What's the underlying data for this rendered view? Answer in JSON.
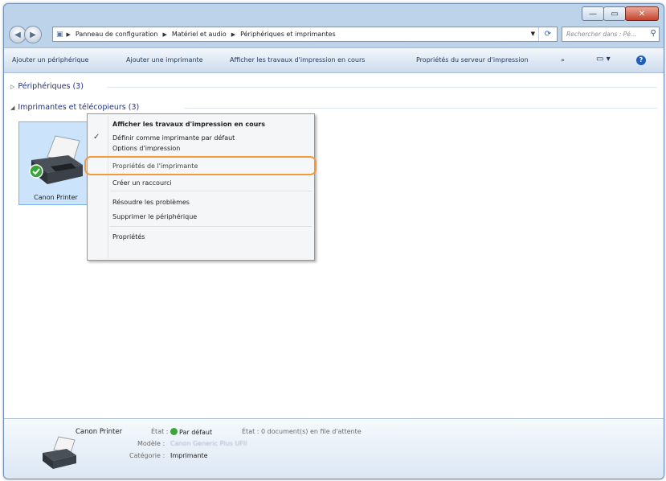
{
  "window": {
    "buttons": {
      "minimize": "—",
      "maximize": "▭",
      "close": "✕"
    }
  },
  "address": {
    "crumbs": [
      "Panneau de configuration",
      "Matériel et audio",
      "Périphériques et imprimantes"
    ],
    "search_placeholder": "Rechercher dans : Pé..."
  },
  "toolbar": {
    "items": [
      "Ajouter un périphérique",
      "Ajouter une imprimante",
      "Afficher les travaux d'impression en cours",
      "Propriétés du serveur d'impression"
    ],
    "more": "»"
  },
  "groups": {
    "devices": "Périphériques (3)",
    "printers": "Imprimantes et télécopieurs (3)"
  },
  "printers": [
    {
      "name": "Canon Printer",
      "default": true
    }
  ],
  "context_menu": {
    "items": [
      {
        "label": "Afficher les travaux d'impression en cours",
        "bold": true
      },
      {
        "label": "Définir comme imprimante par défaut",
        "checked": true
      },
      {
        "label": "Options d'impression"
      },
      {
        "label": "Propriétés de l'imprimante",
        "highlighted": true
      },
      {
        "label": "Créer un raccourci"
      },
      {
        "label": "Résoudre les problèmes"
      },
      {
        "label": "Supprimer le périphérique"
      },
      {
        "label": "Propriétés"
      }
    ]
  },
  "details": {
    "name": "Canon Printer",
    "state_key": "État :",
    "state_value": "Par défaut",
    "queue": "État : 0 document(s) en file d'attente",
    "model_key": "Modèle :",
    "model_value": "Canon Generic Plus UFII",
    "category_key": "Catégorie :",
    "category_value": "Imprimante"
  },
  "colors": {
    "highlight": "#f29a3a",
    "link": "#1e3287"
  }
}
